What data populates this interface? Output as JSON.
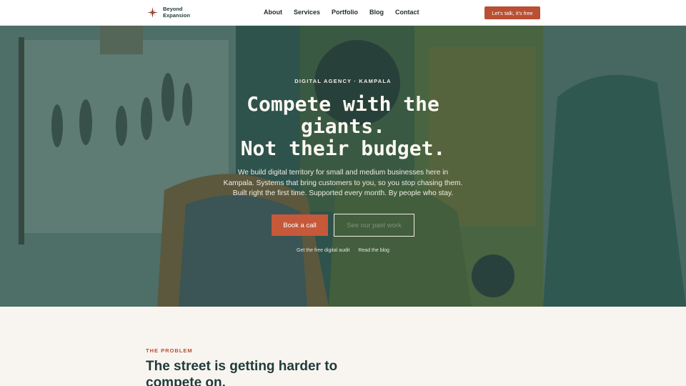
{
  "brand": {
    "name_line1": "Beyond",
    "name_line2": "Expansion"
  },
  "nav": {
    "items": [
      {
        "label": "About"
      },
      {
        "label": "Services"
      },
      {
        "label": "Portfolio"
      },
      {
        "label": "Blog"
      },
      {
        "label": "Contact"
      }
    ]
  },
  "header": {
    "cta_label": "Let's talk, it's free"
  },
  "hero": {
    "eyebrow": "DIGITAL AGENCY · KAMPALA",
    "title_line1": "Compete with the",
    "title_line2": "giants.",
    "title_line3": "Not their budget.",
    "subtitle": "We build digital territory for small and medium businesses here in Kampala. Systems that bring customers to you, so you stop chasing them. Built right the first time. Supported every month. By people who stay.",
    "primary_button": "Book a call",
    "secondary_button": "See our past work",
    "link1": "Get the free digital audit",
    "link2": "Read the blog"
  },
  "problem": {
    "eyebrow": "THE PROBLEM",
    "title": "The street is getting harder to compete on."
  },
  "colors": {
    "accent": "#b94f33",
    "dark_teal": "#1f3b3a",
    "hero_overlay": "#264e48"
  },
  "icons": {
    "logo": "compass-star-icon"
  }
}
